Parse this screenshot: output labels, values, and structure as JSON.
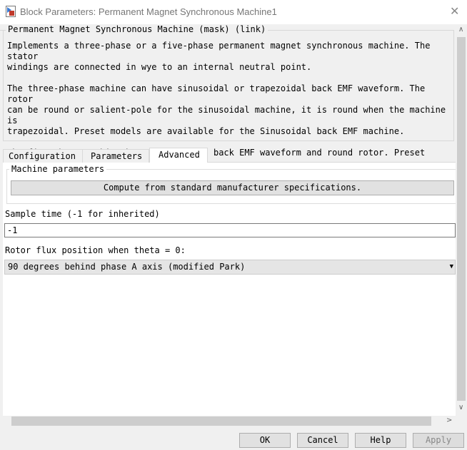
{
  "window": {
    "title": "Block Parameters: Permanent Magnet Synchronous Machine1"
  },
  "mask": {
    "title": "Permanent Magnet Synchronous Machine (mask) (link)",
    "description": "Implements a three-phase or a five-phase permanent magnet synchronous machine. The stator\nwindings are connected in wye to an internal neutral point.\n\nThe three-phase machine can have sinusoidal or trapezoidal back EMF waveform. The rotor\ncan be round or salient-pole for the sinusoidal machine, it is round when the machine is\ntrapezoidal. Preset models are available for the Sinusoidal back EMF machine.\n\nThe five-phase machine has a sinusoidal back EMF waveform and round rotor. Preset models\nare not available for this type of machine."
  },
  "tabs": [
    {
      "label": "Configuration"
    },
    {
      "label": "Parameters"
    },
    {
      "label": "Advanced",
      "active": true
    }
  ],
  "advanced": {
    "machine_parameters_title": "Machine parameters",
    "compute_button": "Compute from standard manufacturer specifications.",
    "sample_time_label": "Sample time (-1 for inherited)",
    "sample_time_value": "-1",
    "rotor_flux_label": "Rotor flux position when theta = 0:",
    "rotor_flux_value": "90 degrees behind phase A axis (modified Park)"
  },
  "buttons": {
    "ok": "OK",
    "cancel": "Cancel",
    "help": "Help",
    "apply": "Apply"
  }
}
